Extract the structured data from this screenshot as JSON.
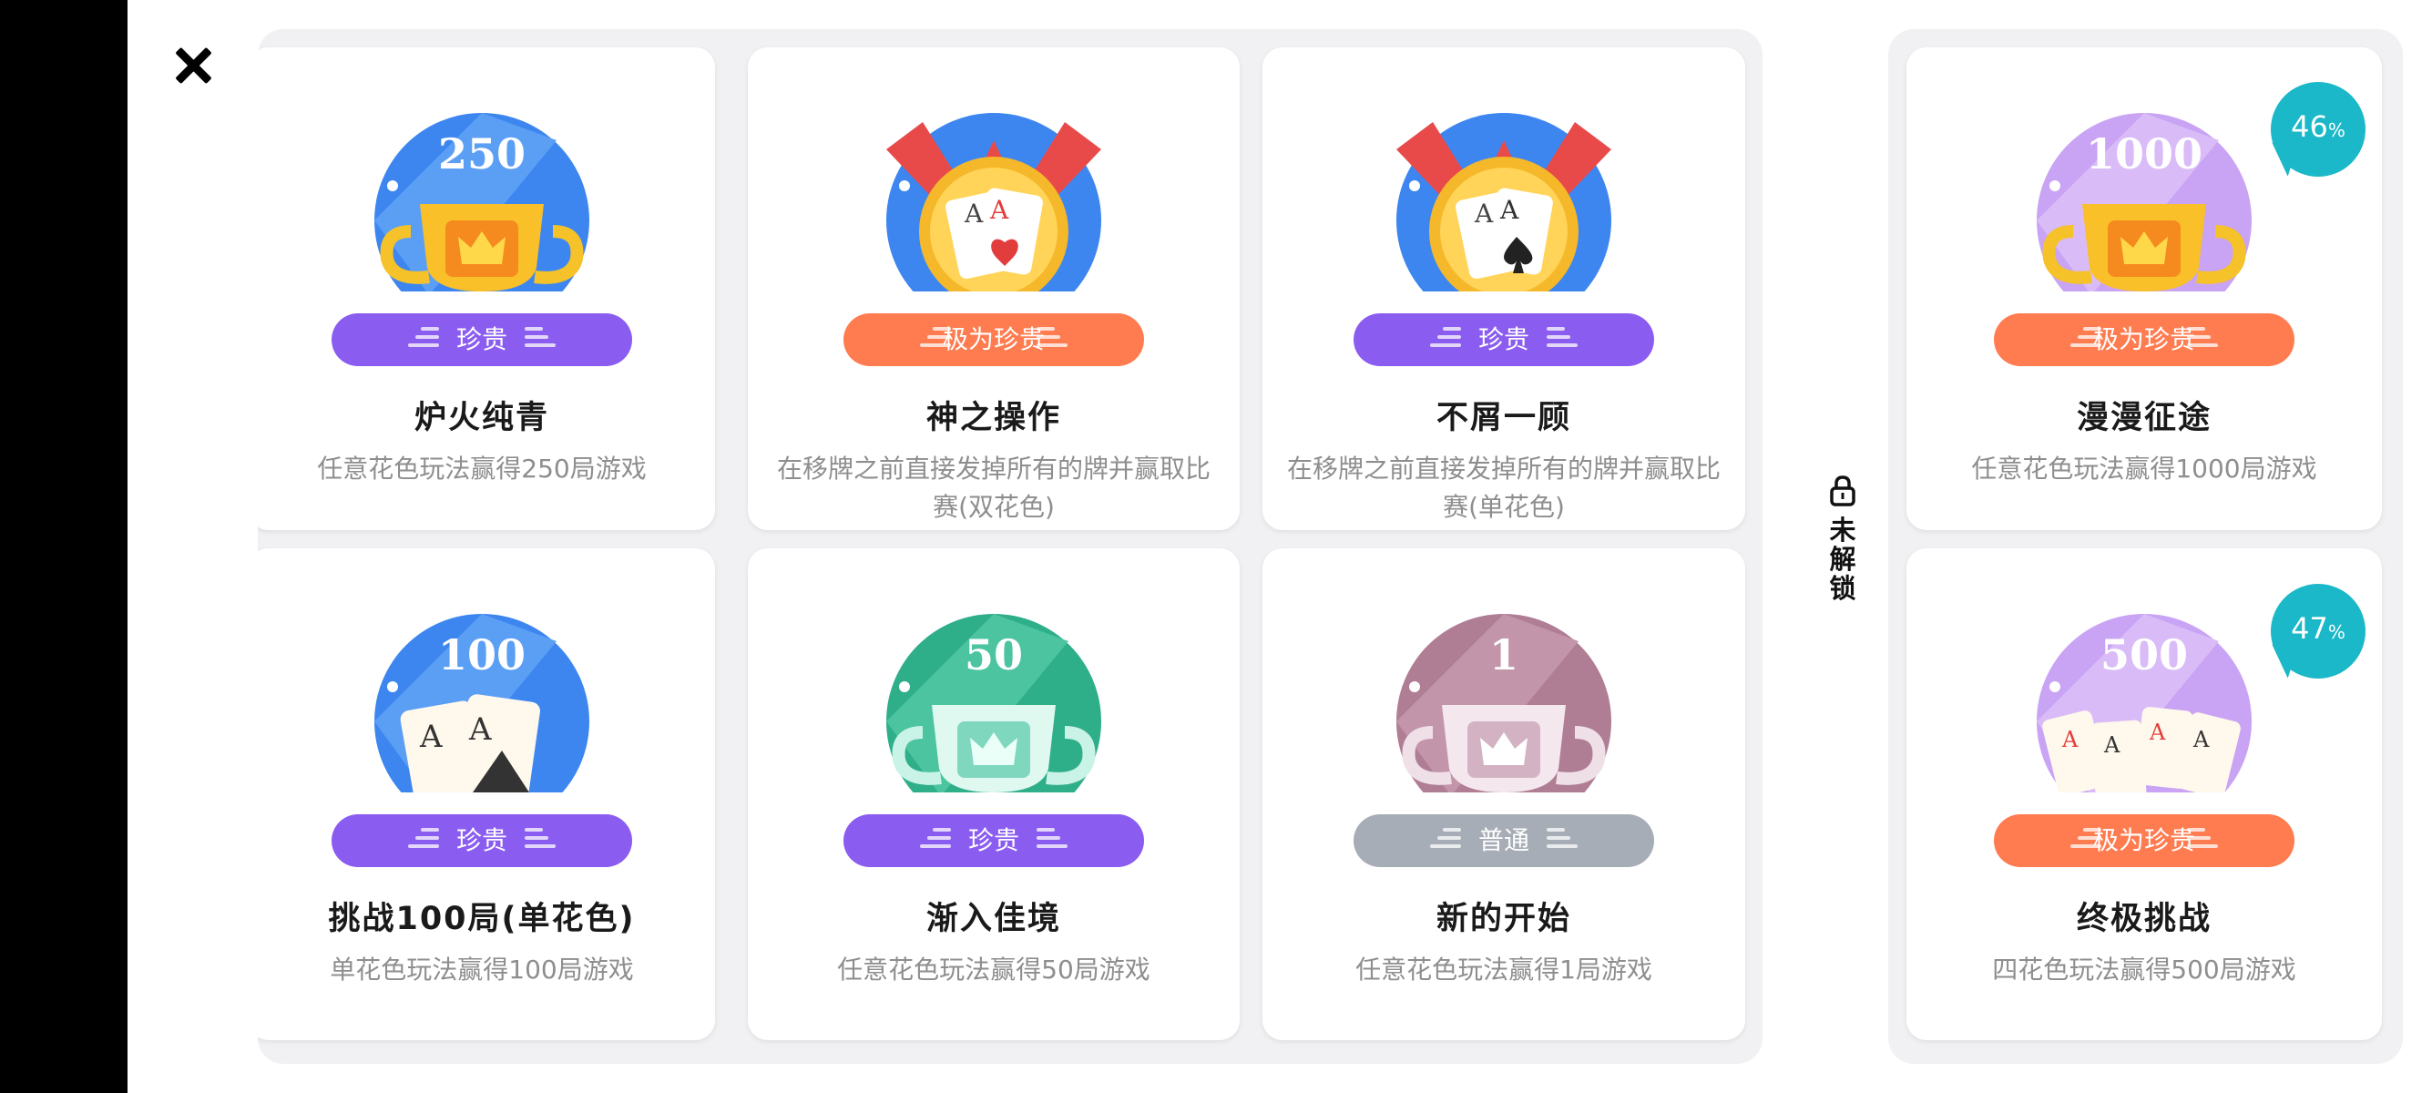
{
  "colors": {
    "precious": "#8a5cf0",
    "epic": "#ff7b50",
    "common": "#a7adb7",
    "progress": "#1ab8c8",
    "panel_bg": "#f1f1f3"
  },
  "unlocked_achievements": [
    {
      "badge_number": "250",
      "badge_art": "gold-trophy-crown",
      "rarity": "珍贵",
      "title": "炉火纯青",
      "desc": "任意花色玩法赢得250局游戏"
    },
    {
      "badge_number": "",
      "badge_art": "aces-hearts-medal",
      "rarity": "极为珍贵",
      "title": "神之操作",
      "desc": "在移牌之前直接发掉所有的牌并赢取比赛(双花色)"
    },
    {
      "badge_number": "",
      "badge_art": "aces-spades-medal",
      "rarity": "珍贵",
      "title": "不屑一顾",
      "desc": "在移牌之前直接发掉所有的牌并赢取比赛(单花色)"
    },
    {
      "badge_number": "100",
      "badge_art": "two-aces-cards",
      "rarity": "珍贵",
      "title": "挑战100局(单花色)",
      "desc": "单花色玩法赢得100局游戏"
    },
    {
      "badge_number": "50",
      "badge_art": "green-trophy-crown",
      "rarity": "珍贵",
      "title": "渐入佳境",
      "desc": "任意花色玩法赢得50局游戏"
    },
    {
      "badge_number": "1",
      "badge_art": "mauve-trophy-crown",
      "rarity": "普通",
      "title": "新的开始",
      "desc": "任意花色玩法赢得1局游戏"
    }
  ],
  "locked_section": {
    "label": "未解锁",
    "icon": "lock-icon"
  },
  "locked_achievements": [
    {
      "badge_number": "1000",
      "badge_art": "faded-gold-trophy-wreath",
      "rarity": "极为珍贵",
      "title": "漫漫征途",
      "desc": "任意花色玩法赢得1000局游戏",
      "progress": "46",
      "progress_unit": "%"
    },
    {
      "badge_number": "500",
      "badge_art": "faded-four-aces-wreath",
      "rarity": "极为珍贵",
      "title": "终极挑战",
      "desc": "四花色玩法赢得500局游戏",
      "progress": "47",
      "progress_unit": "%"
    }
  ]
}
